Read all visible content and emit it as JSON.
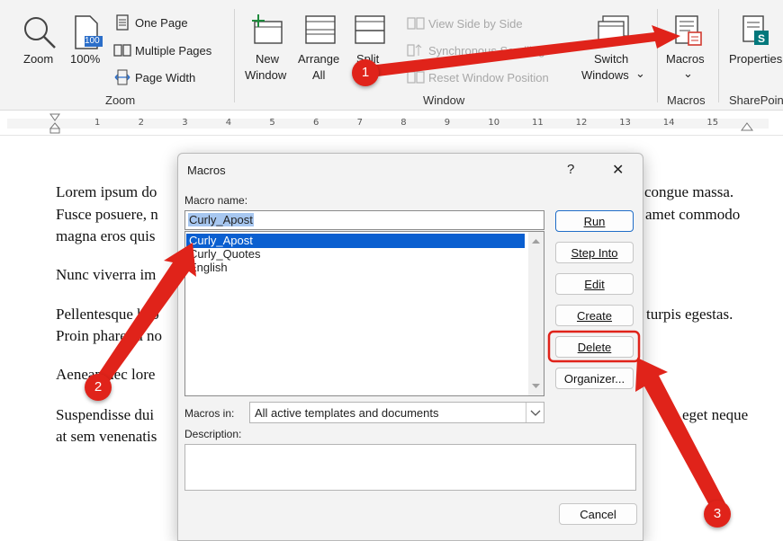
{
  "ribbon": {
    "zoom_group": {
      "zoom_label": "Zoom",
      "hundred_badge": "100",
      "hundred_label": "100%",
      "one_page": "One Page",
      "multiple_pages": "Multiple Pages",
      "page_width": "Page Width",
      "group_label": "Zoom"
    },
    "window_group": {
      "new_window_1": "New",
      "new_window_2": "Window",
      "arrange_all_1": "Arrange",
      "arrange_all_2": "All",
      "split": "Split",
      "view_side_by_side": "View Side by Side",
      "synchronous_scrolling": "Synchronous Scrolling",
      "reset_window_position": "Reset Window Position",
      "switch_windows_1": "Switch",
      "switch_windows_2": "Windows",
      "switch_windows_caret": "⌄",
      "group_label": "Window"
    },
    "macros_group": {
      "macros_label": "Macros",
      "macros_caret": "⌄",
      "group_label": "Macros"
    },
    "sharepoint_group": {
      "properties_label": "Properties",
      "group_label": "SharePoint"
    }
  },
  "ruler": {
    "ticks": [
      "1",
      "2",
      "3",
      "4",
      "5",
      "6",
      "7",
      "8",
      "9",
      "10",
      "11",
      "12",
      "13",
      "14",
      "15"
    ]
  },
  "document": {
    "line1_left": "Lorem ipsum do",
    "line1_right": "congue massa.",
    "line2_left": "Fusce posuere, n",
    "line2_right": "amet commodo",
    "line3_left": "magna eros quis",
    "line4_left": "Nunc viverra im",
    "line5_left": "Pellentesque hab",
    "line5_right": "turpis egestas.",
    "line6_left": "Proin pharetra no",
    "line7_left": "Aenean nec lore",
    "line8_left": "Suspendisse dui",
    "line8_right": "eget neque",
    "line9_left": "at sem venenatis"
  },
  "dialog": {
    "title": "Macros",
    "help_glyph": "?",
    "close_glyph": "✕",
    "macro_name_label": "Macro name:",
    "macro_name_value": "Curly_Apost",
    "macro_list": [
      "Curly_Apost",
      "Curly_Quotes",
      "English"
    ],
    "buttons": {
      "run": "Run",
      "step_into": "Step Into",
      "edit": "Edit",
      "create": "Create",
      "delete": "Delete",
      "organizer": "Organizer...",
      "cancel": "Cancel"
    },
    "macros_in_label": "Macros in:",
    "macros_in_value": "All active templates and documents",
    "description_label": "Description:"
  },
  "annotations": {
    "badge1": "1",
    "badge2": "2",
    "badge3": "3",
    "color": "#e0231a"
  }
}
